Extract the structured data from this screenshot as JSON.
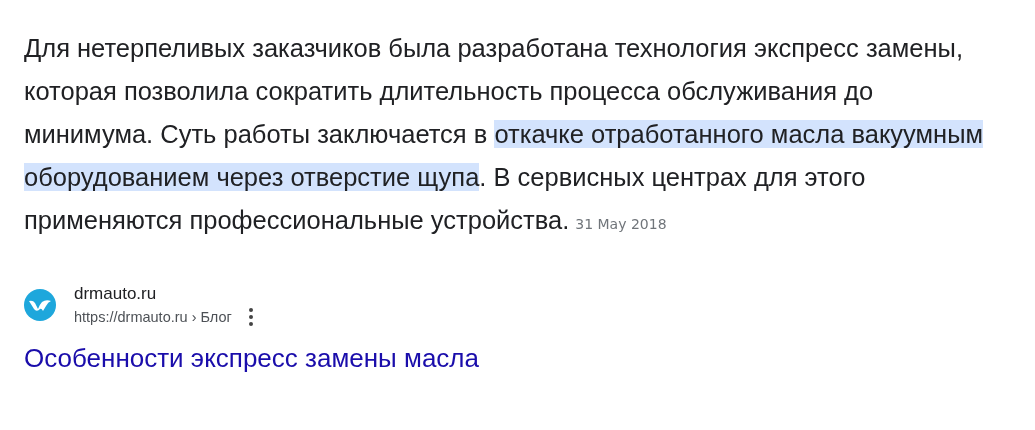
{
  "snippet": {
    "segments": [
      {
        "text": "Для нетерпеливых заказчиков была разработана технология экспресс замены, которая позволила сократить длительность процесса обслуживания до минимума. Суть работы заключается в ",
        "highlighted": false
      },
      {
        "text": "откачке отработанного масла вакуумным оборудованием через отверстие щупа",
        "highlighted": true
      },
      {
        "text": ". В сервисных центрах для этого применяются профессиональные устройства.",
        "highlighted": false
      }
    ],
    "date": "31 May 2018"
  },
  "source": {
    "site_name": "drmauto.ru",
    "url": "https://drmauto.ru",
    "breadcrumb": "› Блог"
  },
  "result_title": "Особенности экспресс замены масла"
}
